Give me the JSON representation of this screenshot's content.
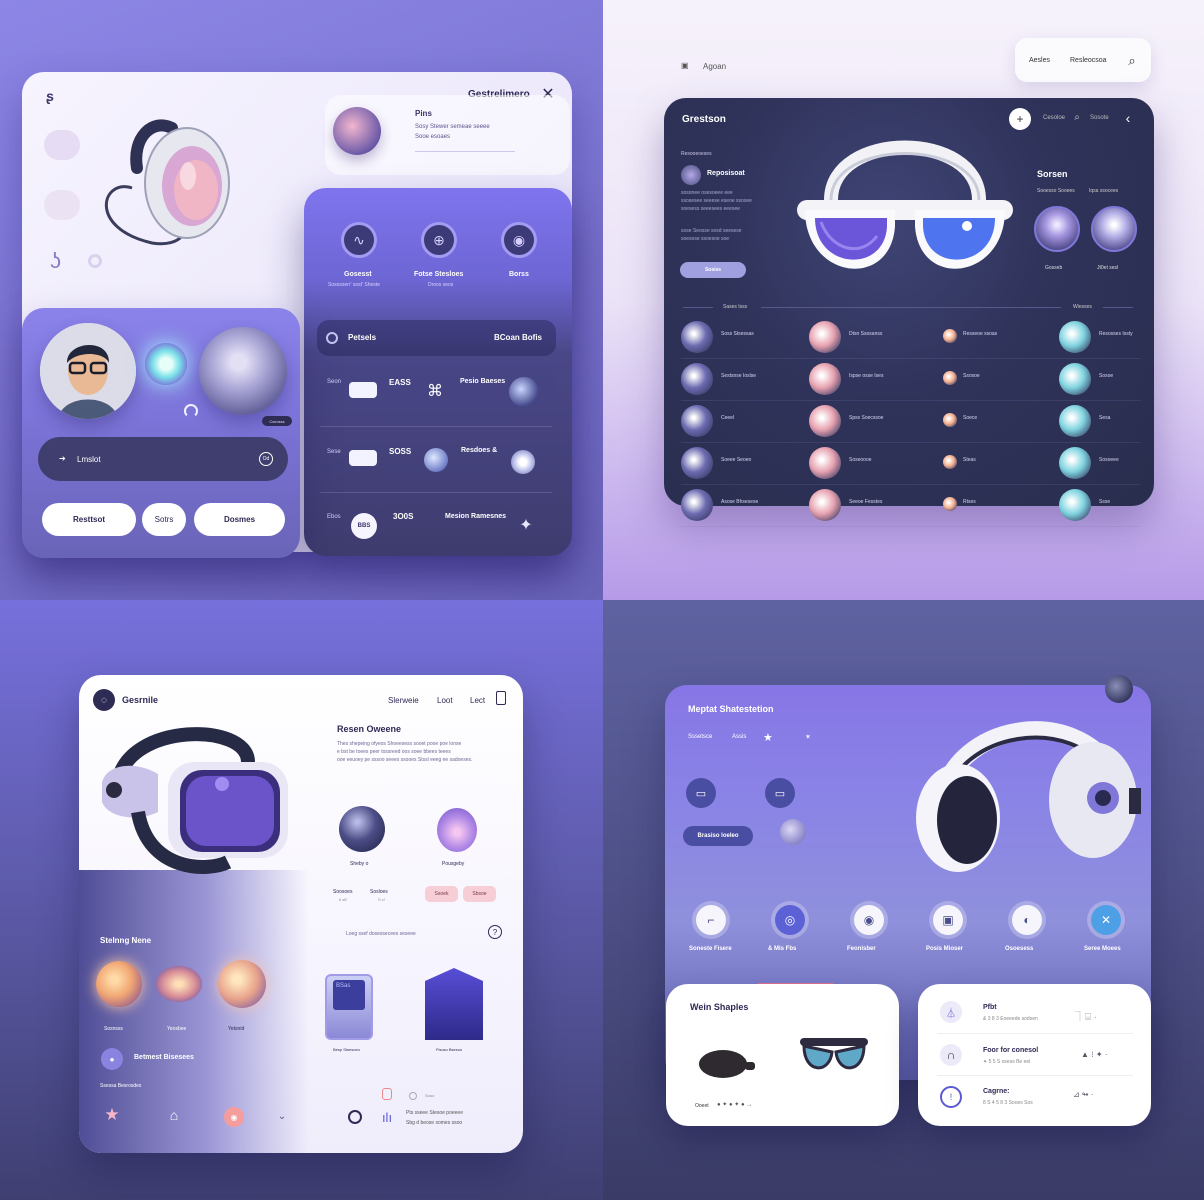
{
  "p1": {
    "title": "Gestrelimero",
    "top_card": {
      "title": "Pins",
      "line1": "Sosy Stewer semeae seeee",
      "line2": "Sooe esoaes"
    },
    "icons": [
      {
        "label": "Gosesst",
        "sub": "Sososserr' sost' Sheste"
      },
      {
        "label": "Fotse Stesloes",
        "sub": "Droos seos"
      },
      {
        "label": "Borss"
      }
    ],
    "list_header": {
      "title": "Petsels",
      "right": "BCoan Bofis"
    },
    "rows": [
      {
        "label": "Seon",
        "value": "EASS",
        "name": "Pesio Baeses"
      },
      {
        "label": "Sese",
        "value": "SOSS",
        "name": "Resdoes &"
      },
      {
        "label": "Ebos",
        "value": "3O0S",
        "name": "Mesion Ramesnes"
      }
    ],
    "row_btn": "BBS",
    "search": "Lmslot",
    "search_btn": "Od",
    "tag": "Cseosss",
    "buttons": [
      "Resttsot",
      "Sotrs",
      "Dosmes"
    ]
  },
  "p2": {
    "nav_left": "Agoan",
    "nav": [
      "Aesles",
      "Resleocsoa"
    ],
    "title": "Grestson",
    "top": [
      "Cesoloe",
      "Sosote"
    ],
    "small_head": "Resooeoeses",
    "info_title": "Reposisoat",
    "info_lines": [
      "sosonee osesoeee eee",
      "ssosesee seeese eseoe ssosee",
      "soesess seeesees eeesee"
    ],
    "info_lines2": [
      "sose Seosse sosd seesese",
      "soesose ssoesoe soe"
    ],
    "cta": "Sosiss",
    "side_title": "Sorsen",
    "side_sub": [
      "Sooesso Sooees",
      "Iqsa ssocees"
    ],
    "avatars": [
      "Gosseb",
      "Jt0et sesl"
    ],
    "sec_left": "Sases Isss",
    "sec_right": "Wiesses",
    "grid": [
      [
        "Soss Stsessas",
        "Dtsn Ssosanss",
        "Resseoe ssoas",
        "Resosses Issty"
      ],
      [
        "Sestsnse Ioslse",
        "Ispse osse Ises",
        "Ssosoe",
        "Sosoe"
      ],
      [
        "Ceeel",
        "Spss Soecssoe",
        "Soece",
        "Sesa"
      ],
      [
        "Soeee Seoeo",
        "Soseoooe",
        "Steas",
        "Sosoeee"
      ],
      [
        "Asose Bhsesese",
        "Seeoe Fesstes",
        "Rtses",
        "Ssse"
      ]
    ]
  },
  "p3": {
    "title": "Gesrnile",
    "nav": [
      "Slerweie",
      "Loot",
      "Lect"
    ],
    "head": "Resen Oweene",
    "lines": [
      "Thes shepeing ofyeos  Shoeesess sooet pooe poe lonse",
      "e bst be toees peer tossreed oos  soee bbees teees",
      "ooe eeuoey pe sssoo  seees ssooes Stssl eeeg ee sadoeses."
    ],
    "c1": "Sheby o",
    "c2": "Pousgeby",
    "mini": [
      "Soosoes",
      "Sosloes"
    ],
    "mini_sub": [
      "b sE",
      "S c!"
    ],
    "chips": [
      "Ssoek",
      "Sbsoe"
    ],
    "hint": "Loeg ssef dosessecees  seseee",
    "section": "Stelnng Nene",
    "planets": [
      "Sosnsss",
      "Yeosbee",
      "Yetsnid"
    ],
    "cards": [
      "Besp Stsesoeo",
      "Fisoso Bsesoo"
    ],
    "screen": "BSas",
    "profile": "Betmest Bisesees",
    "sub": "Ssessa Besrosdes",
    "mini_note": "Sooo",
    "note": [
      "Pts  sseee Stesoe poeeee",
      "Sbg d  beose somes ssoo"
    ]
  },
  "p4": {
    "title": "Meptat Shatestetion",
    "sub": [
      "Sssetsce",
      "Assis"
    ],
    "tag": "Brasiso Ioeleo",
    "icons": [
      "Soneste Fisere",
      "& Mis Fbs",
      "Feonisber",
      "Posis Mioser",
      "Osoesess",
      "Seree Moees"
    ],
    "card1": "Wein Shaples",
    "card1_foot": "Ooeet",
    "list": [
      {
        "title": "Pfbt",
        "sub": "& 3 8 3  Eoeeede sodsen"
      },
      {
        "title": "Foor for conesol",
        "sub": "✦ 5 5  S osess  Be eel"
      },
      {
        "title": "Cagrne:",
        "sub": "8 S 4 5 8 3  Sooes Sos"
      }
    ]
  }
}
